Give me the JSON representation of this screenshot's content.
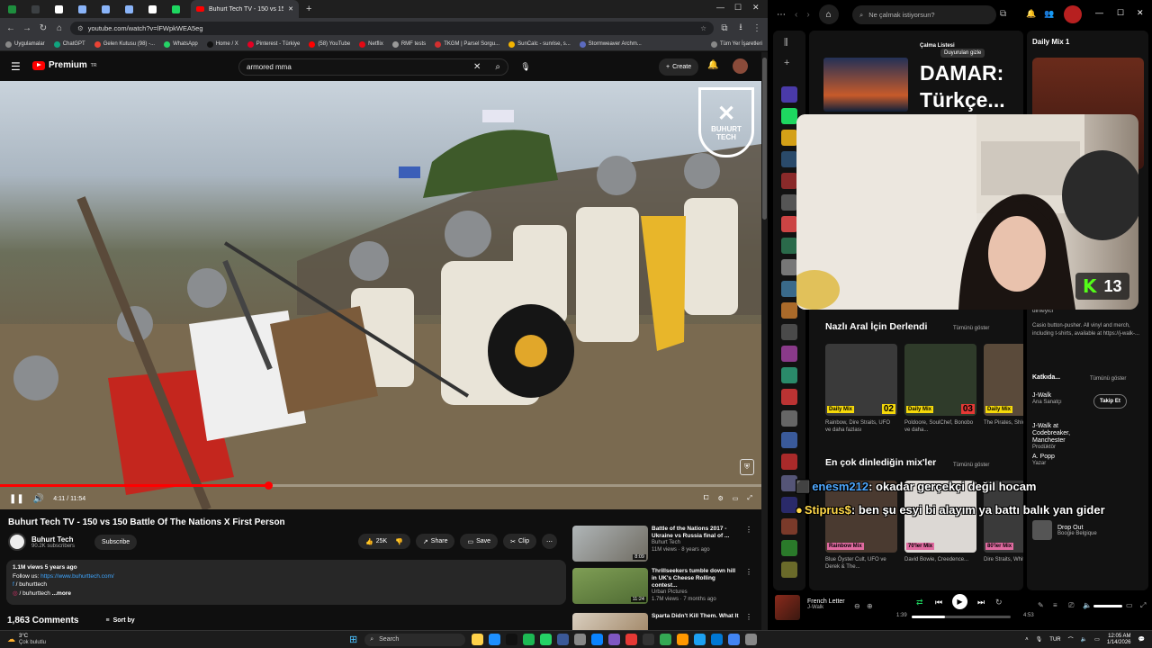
{
  "browser": {
    "active_tab_title": "Buhurt Tech TV - 150 vs 15",
    "tab_favicon_colors": [
      "#1e8e3e",
      "#3c4043",
      "#ffffff",
      "#8ab4f8",
      "#8ab4f8",
      "#8ab4f8",
      "#ffffff",
      "#1ed760"
    ],
    "url": "youtube.com/watch?v=lFWpkWEA5eg",
    "bookmarks": [
      "Uygulamalar",
      "ChatGPT",
      "Gelen Kutusu (98) -...",
      "WhatsApp",
      "Home / X",
      "Pinterest - Türkiye",
      "(58) YouTube",
      "Netflix",
      "RMF tests",
      "TKGM | Parsel Sorgu...",
      "SunCalc - sunrise, s...",
      "Stormweaver Archm...",
      "Tüm Yer İşaretleri"
    ],
    "bookmark_colors": [
      "#888",
      "#10a37f",
      "#ea4335",
      "#25d366",
      "#111",
      "#e60023",
      "#ff0000",
      "#e50914",
      "#999",
      "#d32f2f",
      "#f4b400",
      "#5c6bc0",
      "#888"
    ]
  },
  "youtube": {
    "logo_text": "Premium",
    "logo_sup": "TR",
    "search_value": "armored mma",
    "create_label": "Create",
    "watermark": "BUHURT TECH",
    "time_current": "4:11",
    "time_total": "11:54",
    "progress": 0.352,
    "video_title": "Buhurt Tech TV - 150 vs 150 Battle Of The Nations X First Person",
    "channel_name": "Buhurt Tech",
    "subscribers": "90.2K subscribers",
    "subscribe_label": "Subscribe",
    "likes": "25K",
    "share_label": "Share",
    "save_label": "Save",
    "clip_label": "Clip",
    "views_line": "1.1M views  5 years ago",
    "follow_label": "Follow us:",
    "follow_url": "https://www.buhurttech.com/",
    "social_1": "/ buhurttech",
    "social_2": "/ buhurttech",
    "more_label": "...more",
    "comments_count": "1,863 Comments",
    "sort_label": "Sort by",
    "recommendations": [
      {
        "title": "Battle of the Nations 2017 - Ukraine vs Russia final of ...",
        "channel": "Buhurt Tech",
        "meta": "11M views · 8 years ago",
        "duration": "8:09"
      },
      {
        "title": "Thrillseekers tumble down hill in UK's Cheese Rolling contest...",
        "channel": "Urban Pictures",
        "meta": "1.7M views · 7 months ago",
        "duration": "11:24"
      },
      {
        "title": "Sparta Didn't Kill Them. What It",
        "channel": "",
        "meta": "",
        "duration": ""
      }
    ]
  },
  "spotify": {
    "search_placeholder": "Ne çalmak istiyorsun?",
    "playlist_type": "Çalma Listesi",
    "playlist_name": "DAMAR: Türkçe...",
    "right_title": "Daily Mix 1",
    "tooltip": "Duyurulan gizle",
    "section1_title": "Nazlı Aral İçin Derlendi",
    "section2_title": "En çok dinlediğin mix'ler",
    "show_all": "Tümünü göster",
    "mixes1": [
      {
        "label": "Daily Mix",
        "num": "02",
        "desc": "Rainbow, Dire Straits, UFO ve daha fazlası"
      },
      {
        "label": "Daily Mix",
        "num": "03",
        "desc": "Poldoore, SoulChef, Bonobo ve daha..."
      },
      {
        "label": "Daily Mix",
        "num": "",
        "desc": "The Pirates, Shivaree"
      }
    ],
    "mixes2": [
      {
        "label": "Rainbow Mix",
        "desc": "Blue Öyster Cult, UFO ve Derek & The..."
      },
      {
        "label": "70'ler Mix",
        "desc": "David Bowie, Creedence..."
      },
      {
        "label": "80'ler Mix",
        "desc": "Dire Straits, Whitesnake"
      }
    ],
    "about_label": "dinleyici",
    "about_text": "Casio button-pusher. All vinyl and merch, including t-shirts, available at https://j-walk-...",
    "credits_title": "Katkıda...",
    "credits": [
      {
        "name": "J-Walk",
        "role": "Ana Sanatçı"
      },
      {
        "name": "J-Walk at Codebreaker, Manchester",
        "role": "Prodüktör"
      },
      {
        "name": "A. Popp",
        "role": "Yazar"
      }
    ],
    "follow_label": "Takip Et",
    "next_title": "Drop Out",
    "next_artist": "Boogie Belgique",
    "now_playing_title": "French Letter",
    "now_playing_artist": "J-Walk",
    "time_elapsed": "1:39",
    "time_total": "4:53",
    "progress": 0.34
  },
  "stream": {
    "kick_count": "13",
    "chat": [
      {
        "user": "enesm212",
        "message": ": okadar gerçekçi değil hocam",
        "color": "#4fa8ff"
      },
      {
        "user": "Stiprus$",
        "message": ": ben şu esyi bi alayım ya battı balık yan gider",
        "color": "#ffd84a"
      }
    ]
  },
  "taskbar": {
    "weather_temp": "3°C",
    "weather_desc": "Çok bulutlu",
    "search_label": "Search",
    "lang": "TUR",
    "time": "12:05 AM",
    "date": "1/14/2026",
    "app_colors": [
      "#ffd24a",
      "#1e90ff",
      "#111",
      "#1db954",
      "#25d366",
      "#3b5998",
      "#888",
      "#0a84ff",
      "#7e57c2",
      "#e53935",
      "#333",
      "#34a853",
      "#ff9800",
      "#1da1f2",
      "#0078d4",
      "#4285f4",
      "#888"
    ]
  }
}
